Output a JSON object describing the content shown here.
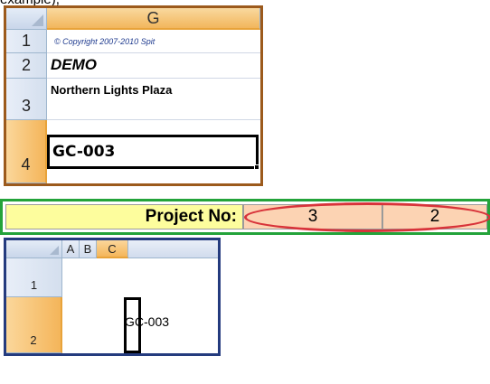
{
  "caption_fragment": "example),",
  "panel1": {
    "column_header": "G",
    "rows": [
      {
        "num": "1",
        "text": "© Copyright 2007-2010 Spit"
      },
      {
        "num": "2",
        "text": "DEMO"
      },
      {
        "num": "3",
        "text": "Northern Lights Plaza"
      },
      {
        "num": "4",
        "text": "GC-003"
      }
    ],
    "colors": {
      "frame": "#9c5a1c",
      "selection_header": "#f4b55a"
    }
  },
  "panel2": {
    "label": "Project No:",
    "values": [
      "3",
      "2"
    ],
    "colors": {
      "frame": "#23a33a",
      "label_fill": "#fdfd9d",
      "value_fill": "#fcd3b3",
      "highlight": "#d8333a"
    }
  },
  "panel3": {
    "columns": [
      "A",
      "B",
      "C"
    ],
    "selected_column": "C",
    "rows": [
      "1",
      "2"
    ],
    "cell_text": "GC-003",
    "colors": {
      "frame": "#243b7e"
    }
  }
}
